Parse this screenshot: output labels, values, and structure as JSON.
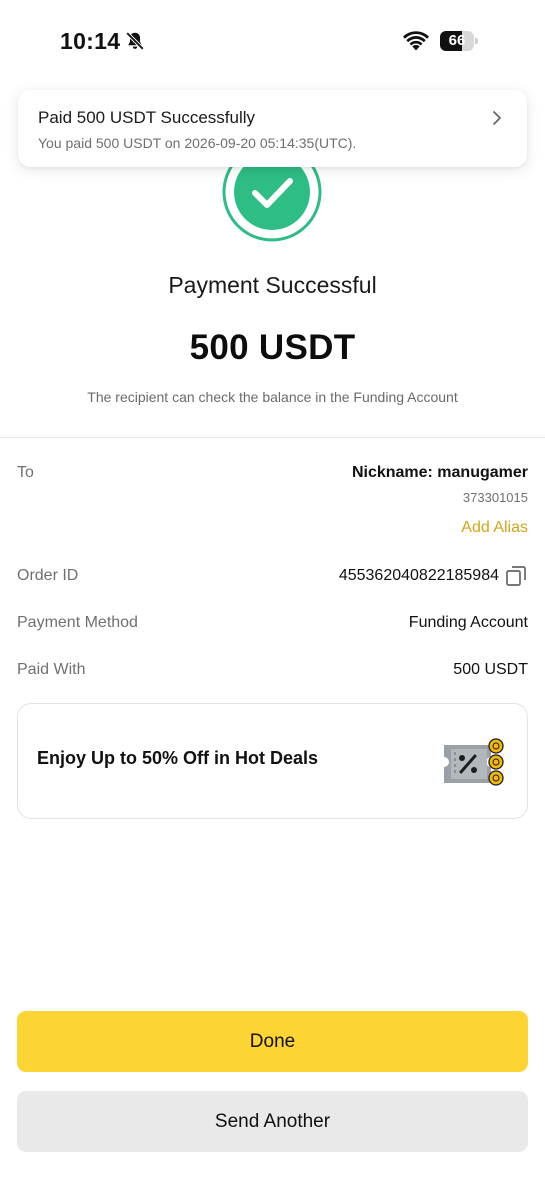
{
  "status_bar": {
    "time": "10:14",
    "battery_percent": "66",
    "battery_level": 0.66
  },
  "notification": {
    "title": "Paid 500 USDT Successfully",
    "subtitle": "You paid 500 USDT on 2026-09-20 05:14:35(UTC)."
  },
  "result": {
    "title": "Payment Successful",
    "amount": "500 USDT",
    "note": "The recipient can check the balance in the Funding Account"
  },
  "details": {
    "to_label": "To",
    "nickname": "Nickname: manugamer",
    "uid": "373301015",
    "add_alias": "Add Alias",
    "order_id_label": "Order ID",
    "order_id": "455362040822185984",
    "payment_method_label": "Payment Method",
    "payment_method": "Funding Account",
    "paid_with_label": "Paid With",
    "paid_with": "500 USDT"
  },
  "promo": {
    "text": "Enjoy Up to 50% Off in Hot Deals"
  },
  "buttons": {
    "done": "Done",
    "send_another": "Send Another"
  },
  "colors": {
    "accent_yellow": "#fcd535",
    "alias_gold": "#d4a418",
    "success_green": "#2ebd85"
  }
}
